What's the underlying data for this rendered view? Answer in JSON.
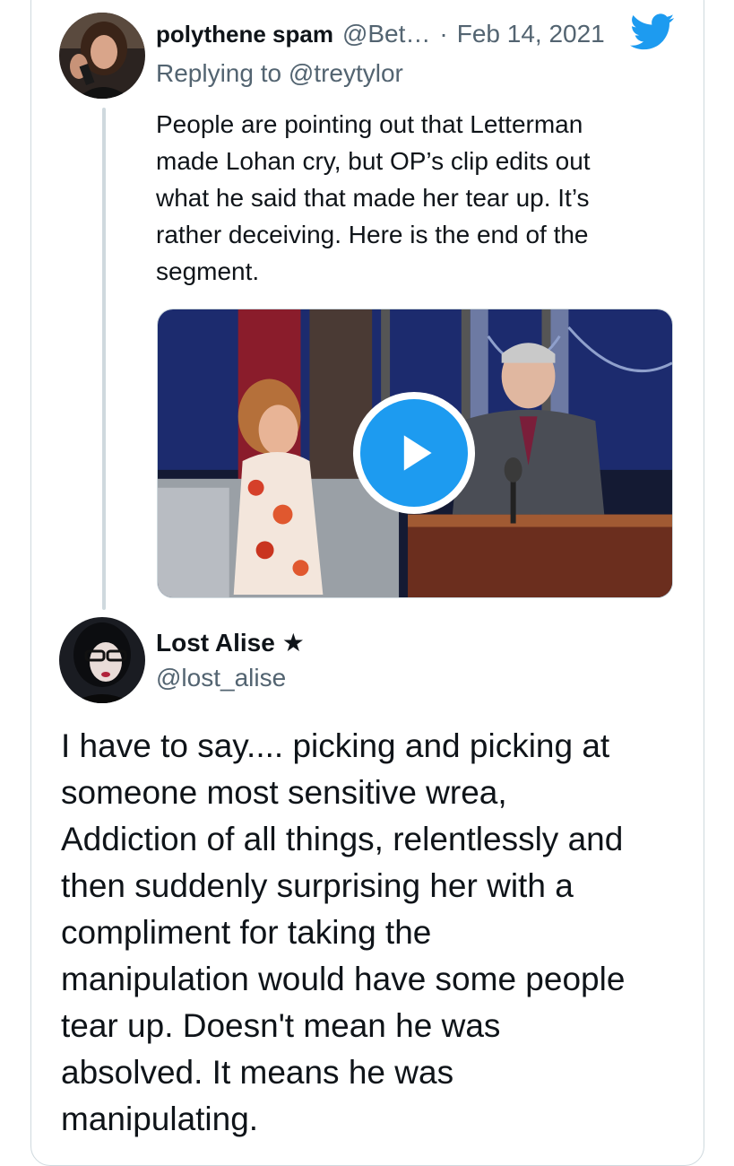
{
  "tweet1": {
    "display_name": "polythene spam",
    "handle": "@Bet…",
    "separator": "·",
    "date": "Feb 14, 2021",
    "replying_to": "Replying to @treytylor",
    "body_lines": [
      "People are pointing out that Letterman",
      "made Lohan cry, but OP’s clip edits out",
      "what he said that made her tear up. It’s",
      "rather deceiving. Here is the end of the",
      "segment."
    ],
    "logo_icon": "twitter-bird-icon",
    "media": {
      "type": "video",
      "play_icon": "play-icon"
    }
  },
  "tweet2": {
    "display_name": "Lost Alise",
    "name_symbol": "★",
    "handle": "@lost_alise",
    "body_lines": [
      "I have to say.... picking and picking at",
      "someone most sensitive wrea,",
      "Addiction of all things, relentlessly and",
      "then suddenly surprising her with a",
      "compliment for taking the",
      "manipulation would have some people",
      "tear up. Doesn't mean he was",
      "absolved. It means he was",
      "manipulating."
    ]
  },
  "colors": {
    "accent": "#1d9bf0",
    "text": "#0f1419",
    "muted": "#536471",
    "border": "#cfd9de"
  }
}
